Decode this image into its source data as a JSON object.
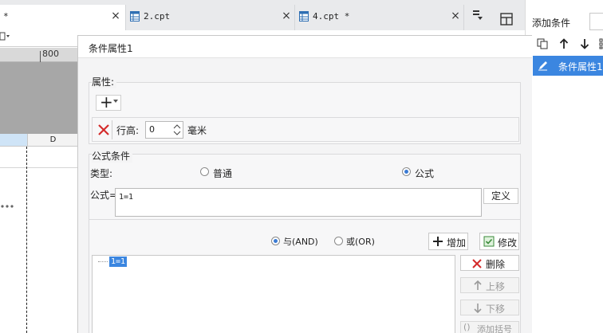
{
  "tabs": [
    {
      "label": "*"
    },
    {
      "label": "2.cpt"
    },
    {
      "label": "4.cpt *"
    }
  ],
  "tab_close_glyph": "×",
  "ruler": {
    "tick_label": "800"
  },
  "sheet": {
    "column_header": "D"
  },
  "right_panel": {
    "title": "添加条件",
    "toolbar": [
      "copy-icon",
      "arrow-up-icon",
      "arrow-down-icon",
      "more-icon"
    ],
    "items": [
      {
        "label": "条件属性1"
      }
    ]
  },
  "dialog": {
    "title": "条件属性1",
    "properties": {
      "legend": "属性:",
      "add_symbol": "+",
      "row_height_label": "行高:",
      "row_height_value": "0",
      "unit": "毫米"
    },
    "formula_condition": {
      "legend": "公式条件",
      "type_label": "类型:",
      "type_options": [
        "普通",
        "公式"
      ],
      "selected_type": "公式",
      "formula_label": "公式=",
      "formula_value": "1=1",
      "define_button": "定义"
    },
    "logic": {
      "and_label": "与(AND)",
      "or_label": "或(OR)",
      "selected": "and",
      "add_button": "增加",
      "modify_button": "修改"
    },
    "tree": {
      "items": [
        "1=1"
      ]
    },
    "side_buttons": {
      "delete": "删除",
      "move_up": "上移",
      "move_down": "下移",
      "add_bracket": "添加括号"
    }
  },
  "colors": {
    "accent": "#3b86e0",
    "tab_strip": "#e9eaec",
    "dialog_bg": "#f4f4f5",
    "delete_red": "#d42b2b"
  }
}
